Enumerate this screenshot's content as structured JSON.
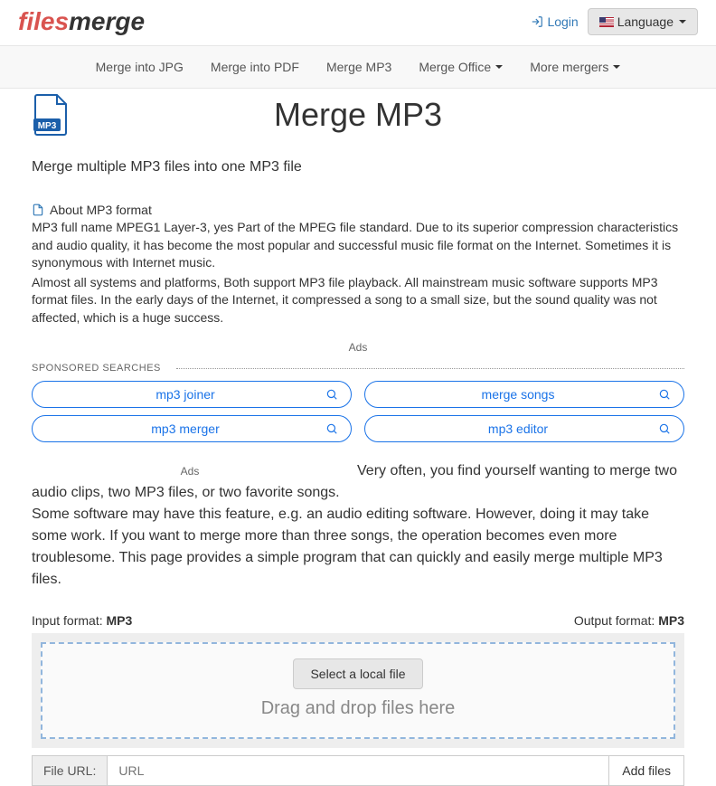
{
  "header": {
    "logo_left": "files",
    "logo_right": "merge",
    "login": "Login",
    "language": "Language"
  },
  "nav": {
    "items": [
      "Merge into JPG",
      "Merge into PDF",
      "Merge MP3",
      "Merge Office",
      "More mergers"
    ],
    "dropdown_flags": [
      false,
      false,
      false,
      true,
      true
    ]
  },
  "page": {
    "title": "Merge MP3",
    "subtitle": "Merge multiple MP3 files into one MP3 file",
    "about_label": "About MP3 format",
    "about_p1": "MP3 full name MPEG1 Layer-3, yes Part of the MPEG file standard. Due to its superior compression characteristics and audio quality, it has become the most popular and successful music file format on the Internet. Sometimes it is synonymous with Internet music.",
    "about_p2": "Almost all systems and platforms, Both support MP3 file playback. All mainstream music software supports MP3 format files. In the early days of the Internet, it compressed a song to a small size, but the sound quality was not affected, which is a huge success.",
    "ads_label": "Ads",
    "sponsored_label": "SPONSORED SEARCHES",
    "sponsored_items": [
      "mp3 joiner",
      "merge songs",
      "mp3 merger",
      "mp3 editor"
    ],
    "body_p1": "Very often, you find yourself wanting to merge two audio clips, two MP3 files, or two favorite songs.",
    "body_p2": "Some software may have this feature, e.g. an audio editing software. However, doing it may take some work. If you want to merge more than three songs, the operation becomes even more troublesome. This page provides a simple program that can quickly and easily merge multiple MP3 files.",
    "input_format_label": "Input format: ",
    "input_format": "MP3",
    "output_format_label": "Output format: ",
    "output_format": "MP3",
    "select_file": "Select a local file",
    "drag_text": "Drag and drop files here",
    "file_url_label": "File URL:",
    "url_placeholder": "URL",
    "add_files": "Add files"
  }
}
